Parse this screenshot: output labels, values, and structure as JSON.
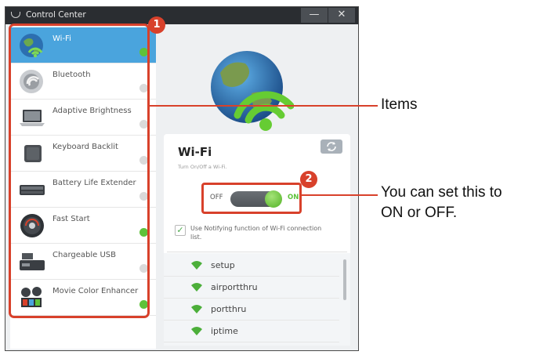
{
  "window": {
    "title": "Control Center",
    "minimize_label": "—",
    "close_label": "✕"
  },
  "sidebar": {
    "items": [
      {
        "label": "Wi-Fi",
        "state": "on",
        "selected": true,
        "icon": "globe-wifi-icon"
      },
      {
        "label": "Bluetooth",
        "state": "off",
        "selected": false,
        "icon": "bluetooth-icon"
      },
      {
        "label": "Adaptive Brightness",
        "state": "off",
        "selected": false,
        "icon": "laptop-icon"
      },
      {
        "label": "Keyboard Backlit",
        "state": "off",
        "selected": false,
        "icon": "keyboard-icon"
      },
      {
        "label": "Battery Life Extender",
        "state": "off",
        "selected": false,
        "icon": "battery-icon"
      },
      {
        "label": "Fast Start",
        "state": "on",
        "selected": false,
        "icon": "speedometer-icon"
      },
      {
        "label": "Chargeable USB",
        "state": "off",
        "selected": false,
        "icon": "usb-icon"
      },
      {
        "label": "Movie Color Enhancer",
        "state": "on",
        "selected": false,
        "icon": "film-icon"
      }
    ]
  },
  "panel": {
    "title": "Wi-Fi",
    "subtitle": "Turn On/Off a Wi-Fi.",
    "switch": {
      "off_label": "OFF",
      "on_label": "ON",
      "state": "on"
    },
    "notify_checkbox": {
      "checked": true,
      "label": "Use Notifying function of Wi-Fi connection list."
    },
    "networks": [
      "setup",
      "airportthru",
      "portthru",
      "iptime"
    ]
  },
  "annotations": {
    "badge1": "1",
    "badge2": "2",
    "items_label": "Items",
    "switch_label_line1": "You can set this to",
    "switch_label_line2": "ON or OFF."
  },
  "colors": {
    "accent": "#4aa4dd",
    "highlight": "#d8412b",
    "on": "#5ec23a",
    "off": "#dadada",
    "titlebar": "#2a2d31"
  }
}
